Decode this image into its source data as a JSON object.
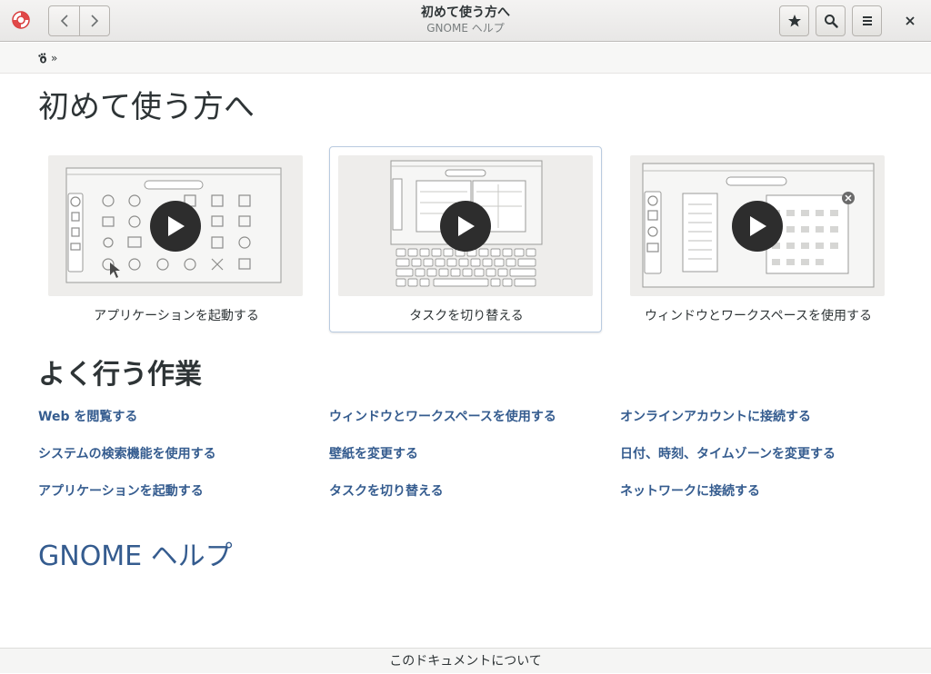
{
  "window": {
    "title": "初めて使う方へ",
    "subtitle": "GNOME ヘルプ"
  },
  "icons": {
    "app": "help-lifebuoy-icon",
    "back": "chevron-left-icon",
    "forward": "chevron-right-icon",
    "bookmark": "star-icon",
    "search": "search-icon",
    "menu": "hamburger-menu-icon",
    "close": "close-icon",
    "home": "gnome-foot-icon",
    "play": "play-icon"
  },
  "breadcrumb": {
    "separator": "»"
  },
  "main": {
    "title": "初めて使う方へ",
    "videos": [
      {
        "caption": "アプリケーションを起動する"
      },
      {
        "caption": "タスクを切り替える"
      },
      {
        "caption": "ウィンドウとワークスペースを使用する"
      }
    ],
    "common_tasks_title": "よく行う作業",
    "links": [
      [
        "Web を閲覧する",
        "ウィンドウとワークスペースを使用する",
        "オンラインアカウントに接続する"
      ],
      [
        "システムの検索機能を使用する",
        "壁紙を変更する",
        "日付、時刻、タイムゾーンを変更する"
      ],
      [
        "アプリケーションを起動する",
        "タスクを切り替える",
        "ネットワークに接続する"
      ]
    ],
    "help_link": "GNOME ヘルプ"
  },
  "footer": {
    "text": "このドキュメントについて"
  },
  "colors": {
    "link": "#355c8f",
    "accent": "#e53935"
  }
}
